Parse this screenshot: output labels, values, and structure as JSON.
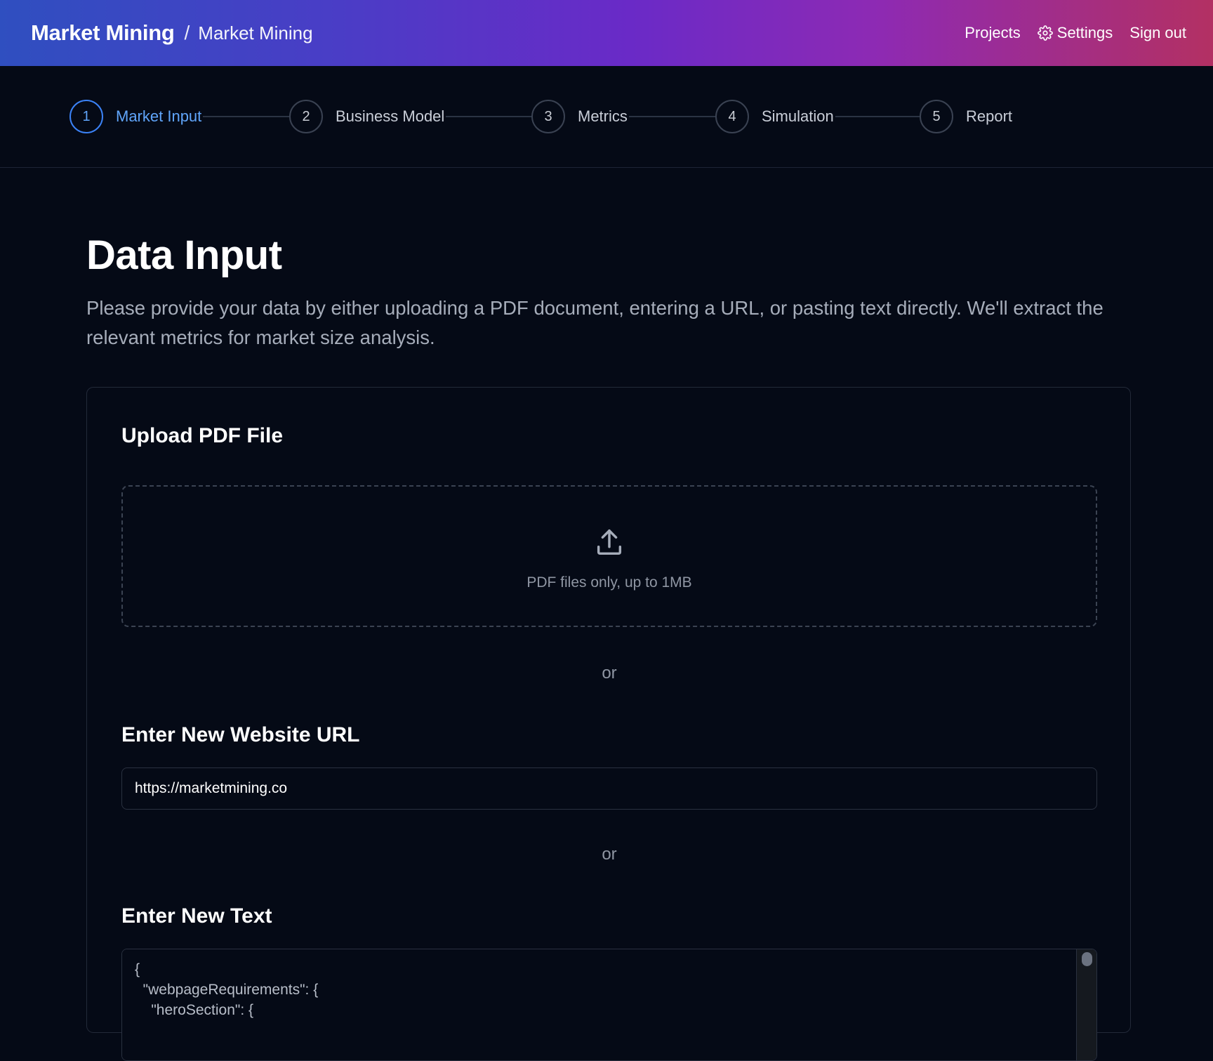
{
  "header": {
    "brand": "Market Mining",
    "separator": "/",
    "project": "Market Mining",
    "nav": {
      "projects": "Projects",
      "settings": "Settings",
      "sign_out": "Sign out"
    }
  },
  "stepper": {
    "active_step": 1,
    "steps": [
      {
        "number": "1",
        "label": "Market Input"
      },
      {
        "number": "2",
        "label": "Business Model"
      },
      {
        "number": "3",
        "label": "Metrics"
      },
      {
        "number": "4",
        "label": "Simulation"
      },
      {
        "number": "5",
        "label": "Report"
      }
    ]
  },
  "page": {
    "title": "Data Input",
    "intro": "Please provide your data by either uploading a PDF document, entering a URL, or pasting text directly. We'll extract the relevant metrics for market size analysis."
  },
  "upload": {
    "title": "Upload PDF File",
    "hint": "PDF files only, up to 1MB",
    "icon": "upload-icon"
  },
  "divider": "or",
  "url": {
    "title": "Enter New Website URL",
    "value": "https://marketmining.co"
  },
  "text": {
    "title": "Enter New Text",
    "value": "{\n  \"webpageRequirements\": {\n    \"heroSection\": {"
  },
  "colors": {
    "accent": "#3b82f6",
    "accent_text": "#60a5fa",
    "background": "#050a16",
    "header_gradient_start": "#2f4fc0",
    "header_gradient_mid": "#6a2ac7",
    "header_gradient_end": "#b33063"
  }
}
